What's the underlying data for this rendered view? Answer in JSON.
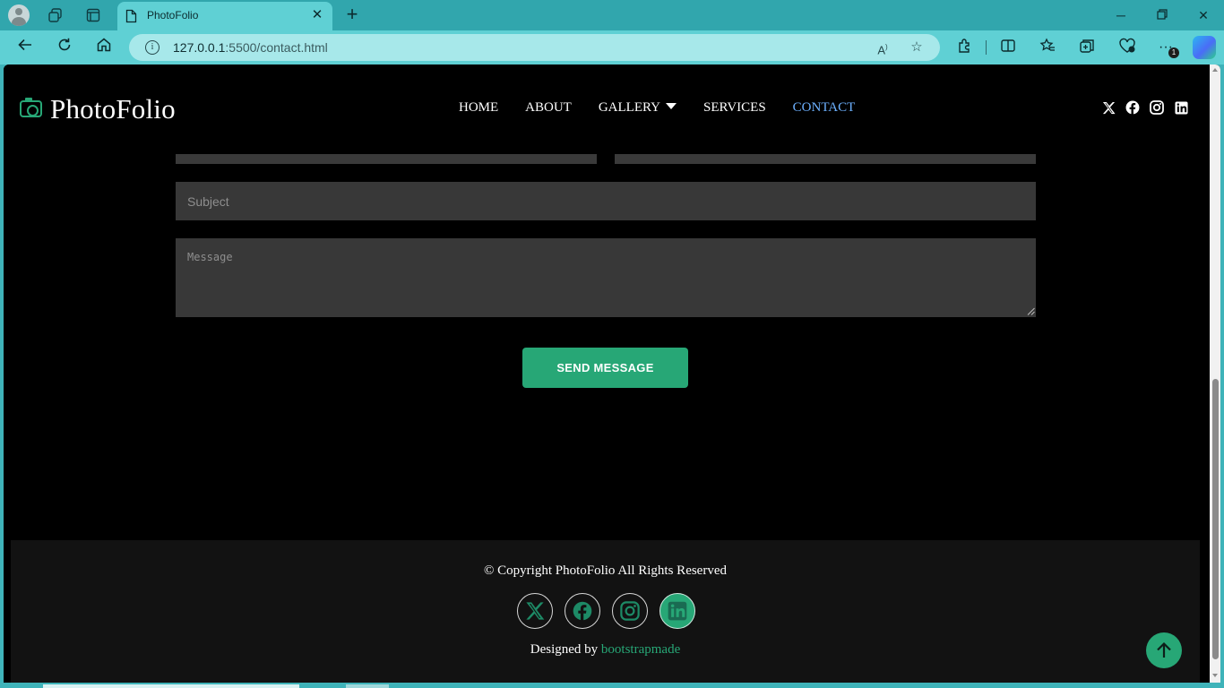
{
  "browser": {
    "tab_title": "PhotoFolio",
    "url_host": "127.0.0.1",
    "url_path": ":5500/contact.html",
    "notification_count": "1"
  },
  "site": {
    "logo": "PhotoFolio",
    "nav": [
      {
        "label": "HOME",
        "active": false
      },
      {
        "label": "ABOUT",
        "active": false
      },
      {
        "label": "GALLERY",
        "active": false
      },
      {
        "label": "SERVICES",
        "active": false
      },
      {
        "label": "CONTACT",
        "active": true
      }
    ],
    "social": [
      "x-icon",
      "facebook-icon",
      "instagram-icon",
      "linkedin-icon"
    ]
  },
  "form": {
    "subject_placeholder": "Subject",
    "message_placeholder": "Message",
    "send_label": "SEND MESSAGE"
  },
  "footer": {
    "copyright": "© Copyright PhotoFolio All Rights Reserved",
    "designed_by": "Designed by",
    "credit": "bootstrapmade"
  },
  "colors": {
    "accent": "#27a776",
    "active_nav": "#6db1ff",
    "background": "#000000",
    "footer_bg": "#121212",
    "browser_frame": "#5fd0d4"
  }
}
